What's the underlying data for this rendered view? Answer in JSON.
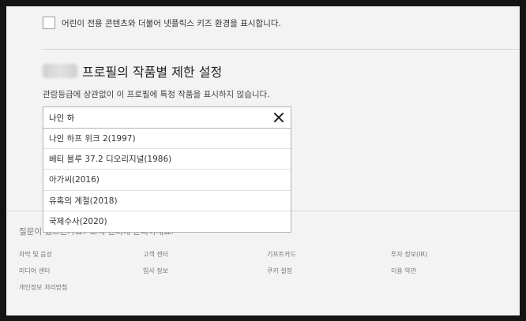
{
  "kids_setting": {
    "checkbox_label": "어린이 전용 콘텐츠와 더불어 넷플릭스 키즈 환경을 표시합니다."
  },
  "restriction": {
    "heading": "프로필의 작품별 제한 설정",
    "description": "관람등급에 상관없이 이 프로필에 특정 작품을 표시하지 않습니다.",
    "search_value": "나인 하",
    "suggestions": [
      "나인 하프 위크 2(1997)",
      "베티 블루 37.2 디오리지널(1986)",
      "아가씨(2016)",
      "유혹의 계절(2018)",
      "국제수사(2020)"
    ]
  },
  "footer": {
    "question": "질문이 있으신가요? 고객 센터에 문의하세요.",
    "links": [
      "자막 및 음성",
      "고객 센터",
      "기프트카드",
      "투자 정보(IR)",
      "미디어 센터",
      "입사 정보",
      "쿠키 설정",
      "이용 약관",
      "개인정보 처리방침"
    ]
  }
}
